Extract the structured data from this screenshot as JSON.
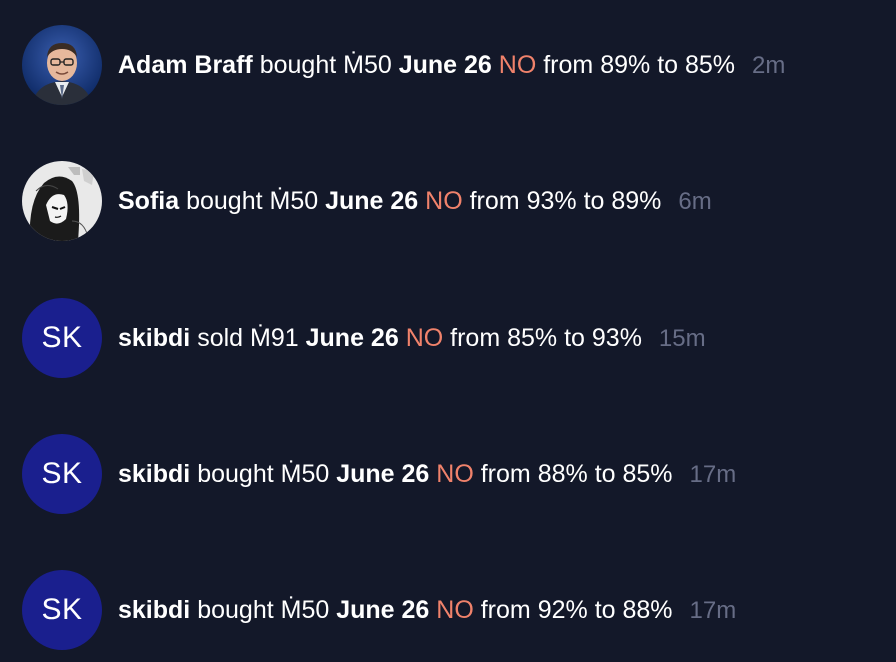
{
  "colors": {
    "background": "#131829",
    "outcome_no": "#f0826b",
    "timestamp": "#676d86",
    "initials_avatar_bg": "#1a1f8e"
  },
  "feed": [
    {
      "user": "Adam Braff",
      "avatar": "photo",
      "action": "bought",
      "currency": "Ṁ",
      "amount": "50",
      "contract": "June 26",
      "outcome": "NO",
      "from_label": "from",
      "from": "89%",
      "to_label": "to",
      "to": "85%",
      "time": "2m"
    },
    {
      "user": "Sofia",
      "avatar": "drawing",
      "action": "bought",
      "currency": "Ṁ",
      "amount": "50",
      "contract": "June 26",
      "outcome": "NO",
      "from_label": "from",
      "from": "93%",
      "to_label": "to",
      "to": "89%",
      "time": "6m"
    },
    {
      "user": "skibdi",
      "avatar": "SK",
      "action": "sold",
      "currency": "Ṁ",
      "amount": "91",
      "contract": "June 26",
      "outcome": "NO",
      "from_label": "from",
      "from": "85%",
      "to_label": "to",
      "to": "93%",
      "time": "15m"
    },
    {
      "user": "skibdi",
      "avatar": "SK",
      "action": "bought",
      "currency": "Ṁ",
      "amount": "50",
      "contract": "June 26",
      "outcome": "NO",
      "from_label": "from",
      "from": "88%",
      "to_label": "to",
      "to": "85%",
      "time": "17m"
    },
    {
      "user": "skibdi",
      "avatar": "SK",
      "action": "bought",
      "currency": "Ṁ",
      "amount": "50",
      "contract": "June 26",
      "outcome": "NO",
      "from_label": "from",
      "from": "92%",
      "to_label": "to",
      "to": "88%",
      "time": "17m"
    }
  ]
}
